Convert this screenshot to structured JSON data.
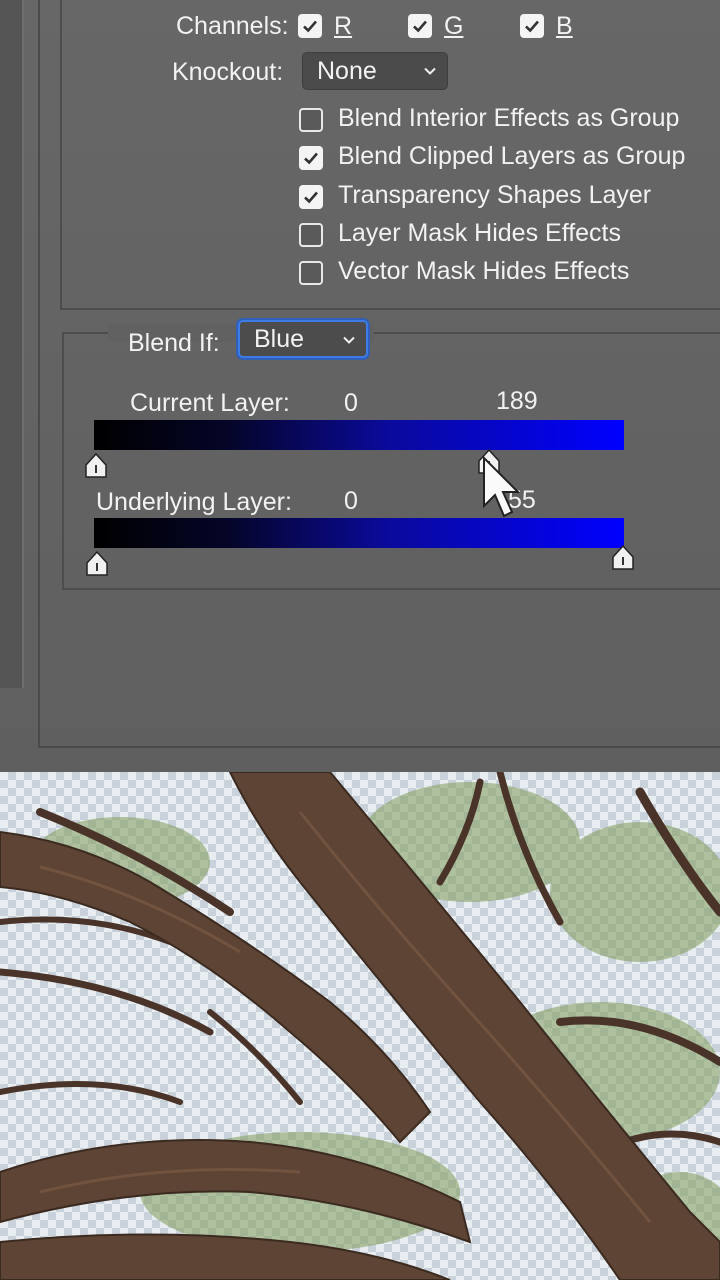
{
  "advanced": {
    "channels_label": "Channels:",
    "channels": [
      {
        "label": "R",
        "checked": true
      },
      {
        "label": "G",
        "checked": true
      },
      {
        "label": "B",
        "checked": true
      }
    ],
    "knockout_label": "Knockout:",
    "knockout_value": "None",
    "options": [
      {
        "label": "Blend Interior Effects as Group",
        "checked": false
      },
      {
        "label": "Blend Clipped Layers as Group",
        "checked": true
      },
      {
        "label": "Transparency Shapes Layer",
        "checked": true
      },
      {
        "label": "Layer Mask Hides Effects",
        "checked": false
      },
      {
        "label": "Vector Mask Hides Effects",
        "checked": false
      }
    ]
  },
  "blend_if": {
    "label": "Blend If:",
    "value": "Blue",
    "current_layer": {
      "label": "Current Layer:",
      "low": "0",
      "high": "189"
    },
    "underlying_layer": {
      "label": "Underlying Layer:",
      "low": "0",
      "high": "255",
      "high_visible": "55"
    },
    "gradient_color": "#0000ff"
  },
  "icons": [
    "check-icon",
    "chevron-down-icon",
    "slider-handle-icon",
    "cursor-arrow-icon"
  ],
  "colors": {
    "dialog_bg": "#646464",
    "focus_ring": "#3d7be6",
    "gradient_end": "#0000ff"
  }
}
